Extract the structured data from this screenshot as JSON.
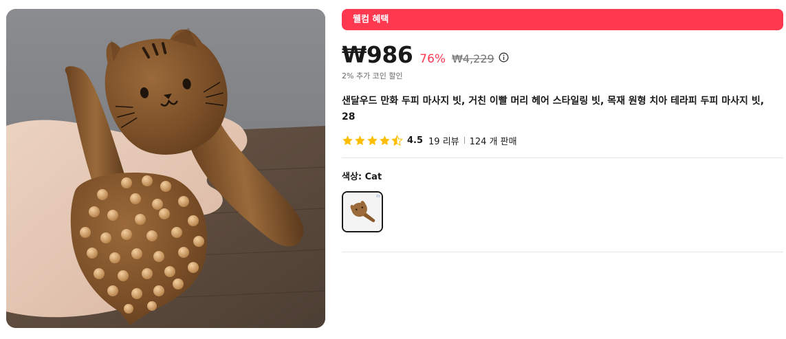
{
  "product_image": {
    "alt": "Sandalwood cat-shaped massage combs held in hand"
  },
  "promo": {
    "label": "웰컴 혜택"
  },
  "price": {
    "current": "₩986",
    "discount": "76%",
    "original": "₩4,229",
    "info_icon": "info-icon",
    "coin_note": "2% 추가 코인 할인"
  },
  "product": {
    "title": "샌달우드 만화 두피 마사지 빗, 거친 이빨 머리 헤어 스타일링 빗, 목재 원형 치아 테라피 두피 마사지 빗, 28"
  },
  "rating": {
    "stars": 4.5,
    "score": "4.5",
    "reviews": "19 리뷰",
    "sold": "124 개 판매",
    "star_color": "#fdbd00"
  },
  "color_option": {
    "label": "색상: Cat",
    "swatches": [
      {
        "name": "Cat",
        "selected": true
      }
    ]
  },
  "colors": {
    "accent": "#fd384f",
    "text": "#191919",
    "muted": "#757575"
  }
}
